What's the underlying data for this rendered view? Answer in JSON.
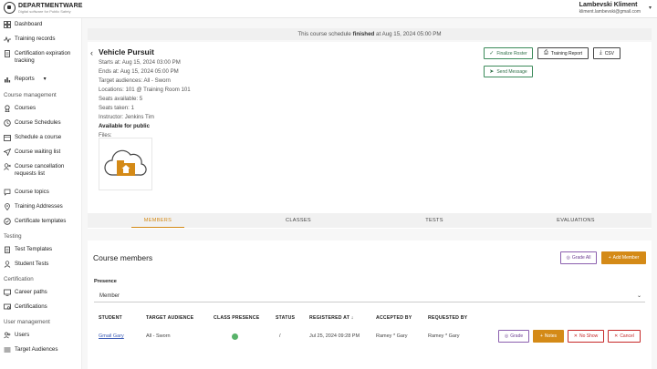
{
  "brand": {
    "name": "DEPARTMENTWARE",
    "tagline": "Digital software for Public Safety"
  },
  "user": {
    "name": "Lambevski Kliment",
    "email": "kliment.lambevski@gmail.com"
  },
  "sidebar": {
    "items": [
      {
        "label": "Dashboard",
        "icon": "grid-icon"
      },
      {
        "label": "Training records",
        "icon": "pulse-icon"
      },
      {
        "label": "Certification expiration tracking",
        "icon": "document-icon"
      },
      {
        "label": "Reports",
        "icon": "chart-icon"
      }
    ],
    "course_management": {
      "heading": "Course management",
      "items": [
        {
          "label": "Courses"
        },
        {
          "label": "Course Schedules"
        },
        {
          "label": "Schedule a course"
        },
        {
          "label": "Course waiting list"
        },
        {
          "label": "Course cancellation requests list"
        },
        {
          "label": "Course topics"
        },
        {
          "label": "Training Addresses"
        },
        {
          "label": "Certificate templates"
        }
      ]
    },
    "testing": {
      "heading": "Testing",
      "items": [
        {
          "label": "Test Templates"
        },
        {
          "label": "Student Tests"
        }
      ]
    },
    "certification": {
      "heading": "Certification",
      "items": [
        {
          "label": "Career paths"
        },
        {
          "label": "Certifications"
        }
      ]
    },
    "user_management": {
      "heading": "User management",
      "items": [
        {
          "label": "Users"
        },
        {
          "label": "Target Audiences"
        }
      ]
    }
  },
  "banner": {
    "prefix": "This course schedule ",
    "status": "finished",
    "suffix": " at Aug 15, 2024 05:00 PM"
  },
  "course": {
    "title": "Vehicle Pursuit",
    "starts": "Starts at: Aug 15, 2024 03:00 PM",
    "ends": "Ends at: Aug 15, 2024 05:00 PM",
    "audiences": "Target audiences: All - Sworn",
    "locations": "Locations: 101 @ Training Room 101",
    "seats_available": "Seats available: 5",
    "seats_taken": "Seats taken: 1",
    "instructor": "Instructor: Jenkins Tim",
    "public": "Available for public",
    "files": "Files:"
  },
  "actions": {
    "finalize": "Finalize Roster",
    "report": "Training Report",
    "csv": "CSV",
    "message": "Send Message"
  },
  "tabs": [
    "MEMBERS",
    "CLASSES",
    "TESTS",
    "EVALUATIONS"
  ],
  "members": {
    "title": "Course members",
    "grade_all": "Grade All",
    "add_member": "Add Member",
    "presence_label": "Presence",
    "presence_value": "Member",
    "columns": [
      "STUDENT",
      "TARGET AUDIENCE",
      "CLASS PRESENCE",
      "STATUS",
      "REGISTERED AT",
      "ACCEPTED BY",
      "REQUESTED BY"
    ],
    "rows": [
      {
        "student": "Gmail Gary",
        "audience": "All - Sworn",
        "status": "/",
        "registered": "Jul 25, 2024 09:28 PM",
        "accepted_by": "Ramey * Gary",
        "requested_by": "Ramey * Gary"
      }
    ],
    "row_actions": {
      "grade": "Grade",
      "notes": "Notes",
      "noshow": "No Show",
      "cancel": "Cancel"
    }
  },
  "colors": {
    "accent": "#d48a17",
    "purple": "#8b5fae",
    "danger": "#c62828",
    "success": "#58b36a"
  }
}
